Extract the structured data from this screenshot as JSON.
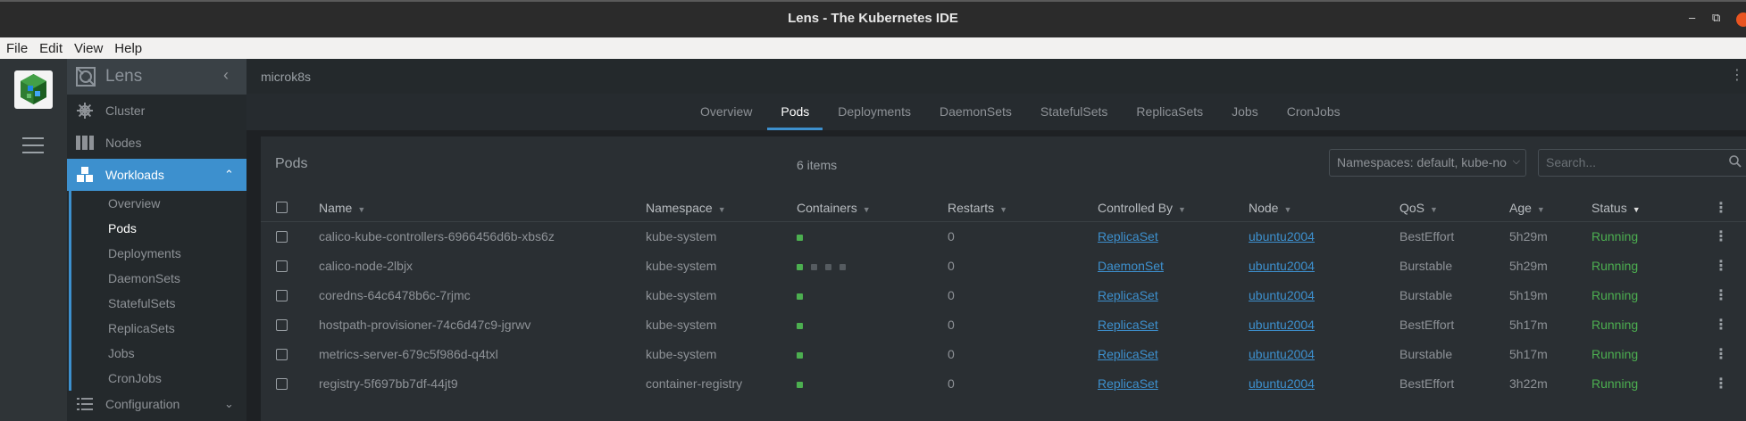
{
  "window": {
    "title": "Lens - The Kubernetes IDE",
    "minimize": "‒",
    "maximize": "⧉"
  },
  "menu": [
    "File",
    "Edit",
    "View",
    "Help"
  ],
  "sidebar": {
    "app_name": "Lens",
    "collapse_glyph": "‹",
    "items": [
      {
        "label": "Cluster",
        "icon": "helm-wheel-icon"
      },
      {
        "label": "Nodes",
        "icon": "server-rack-icon"
      },
      {
        "label": "Workloads",
        "icon": "cubes-icon"
      },
      {
        "label": "Configuration",
        "icon": "list-icon"
      }
    ],
    "workloads_sub": [
      "Overview",
      "Pods",
      "Deployments",
      "DaemonSets",
      "StatefulSets",
      "ReplicaSets",
      "Jobs",
      "CronJobs"
    ]
  },
  "cluster_name": "microk8s",
  "tabs": [
    "Overview",
    "Pods",
    "Deployments",
    "DaemonSets",
    "StatefulSets",
    "ReplicaSets",
    "Jobs",
    "CronJobs"
  ],
  "panel": {
    "title": "Pods",
    "count": "6 items",
    "namespace_select": "Namespaces: default, kube-no",
    "search_placeholder": "Search..."
  },
  "columns": [
    "Name",
    "Namespace",
    "Containers",
    "Restarts",
    "Controlled By",
    "Node",
    "QoS",
    "Age",
    "Status"
  ],
  "rows": [
    {
      "name": "calico-kube-controllers-6966456d6b-xbs6z",
      "namespace": "kube-system",
      "restarts": "0",
      "controlled_by": "ReplicaSet",
      "node": "ubuntu2004",
      "qos": "BestEffort",
      "age": "5h29m",
      "status": "Running"
    },
    {
      "name": "calico-node-2lbjx",
      "namespace": "kube-system",
      "restarts": "0",
      "controlled_by": "DaemonSet",
      "node": "ubuntu2004",
      "qos": "Burstable",
      "age": "5h29m",
      "status": "Running"
    },
    {
      "name": "coredns-64c6478b6c-7rjmc",
      "namespace": "kube-system",
      "restarts": "0",
      "controlled_by": "ReplicaSet",
      "node": "ubuntu2004",
      "qos": "Burstable",
      "age": "5h19m",
      "status": "Running"
    },
    {
      "name": "hostpath-provisioner-74c6d47c9-jgrwv",
      "namespace": "kube-system",
      "restarts": "0",
      "controlled_by": "ReplicaSet",
      "node": "ubuntu2004",
      "qos": "BestEffort",
      "age": "5h17m",
      "status": "Running"
    },
    {
      "name": "metrics-server-679c5f986d-q4txl",
      "namespace": "kube-system",
      "restarts": "0",
      "controlled_by": "ReplicaSet",
      "node": "ubuntu2004",
      "qos": "Burstable",
      "age": "5h17m",
      "status": "Running"
    },
    {
      "name": "registry-5f697bb7df-44jt9",
      "namespace": "container-registry",
      "restarts": "0",
      "controlled_by": "ReplicaSet",
      "node": "ubuntu2004",
      "qos": "BestEffort",
      "age": "3h22m",
      "status": "Running"
    }
  ],
  "colors": {
    "accent": "#3d90ce",
    "running": "#4caf50",
    "background": "#1e2124"
  }
}
